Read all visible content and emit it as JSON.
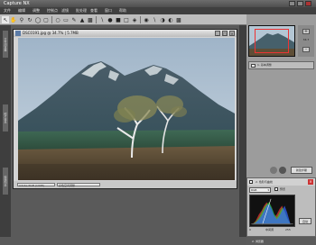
{
  "app": {
    "title": "Capture NX",
    "accent_color": "#2c5e9e",
    "menus": [
      "文件",
      "编辑",
      "调整",
      "控制点",
      "滤镜",
      "批处理",
      "查看",
      "窗口",
      "帮助"
    ]
  },
  "toolbar": {
    "tools": [
      "arrow-icon",
      "hand-icon",
      "zoom-icon",
      "rotate-icon",
      "straighten-icon",
      "crop-icon",
      "lasso-icon",
      "marquee-icon",
      "brush-icon",
      "fill-icon",
      "gradient-icon",
      "picker-icon",
      "color-point-icon",
      "black-point-icon",
      "white-point-icon",
      "neutral-point-icon",
      "red-eye-icon",
      "selection-brush-icon",
      "selection-lasso-icon"
    ]
  },
  "left_strip": {
    "tabs": [
      "文件浏览器",
      "照片信息",
      "编辑列表"
    ]
  },
  "document": {
    "title": "DSC0191.jpg @ 34.7% | 5.7MB",
    "status_zoom": "Adobe RGB (1998)",
    "status_mode": "彩色空间调整"
  },
  "right_panel": {
    "zoom_value": "34.7",
    "base_adjust_label": "1. 基本调整",
    "new_step_label": "新建步骤",
    "levels": {
      "title": "2. 色阶与曲线",
      "channel": "RGB",
      "preview_label": "预览",
      "auto_label": "自动",
      "labels": [
        "0",
        "中间调",
        "255"
      ]
    },
    "bottom_label": "2. 浏览器"
  }
}
